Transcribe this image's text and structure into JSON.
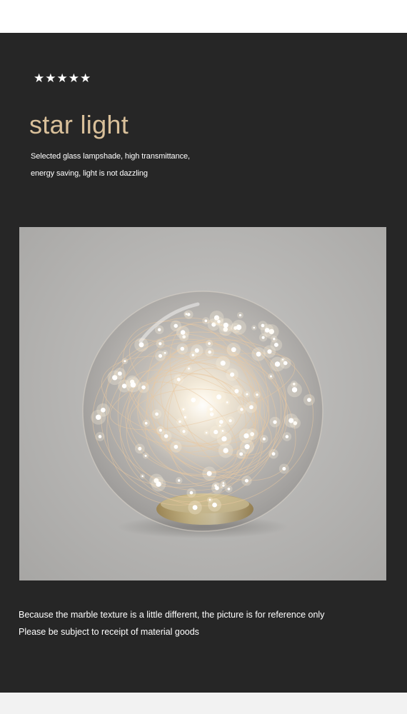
{
  "header": {
    "rating_stars": "★★★★★",
    "title": "star light",
    "description_line1": "Selected glass lampshade, high transmittance,",
    "description_line2": "energy saving, light is not dazzling"
  },
  "image": {
    "subject": "glass-globe-star-lamp"
  },
  "footer": {
    "note_line1": "Because the marble texture is a little different, the picture is for reference only",
    "note_line2": "Please be subject to receipt of material goods"
  },
  "colors": {
    "panel_background": "#262626",
    "title_color": "#d9c09a",
    "text_color": "#ffffff"
  }
}
